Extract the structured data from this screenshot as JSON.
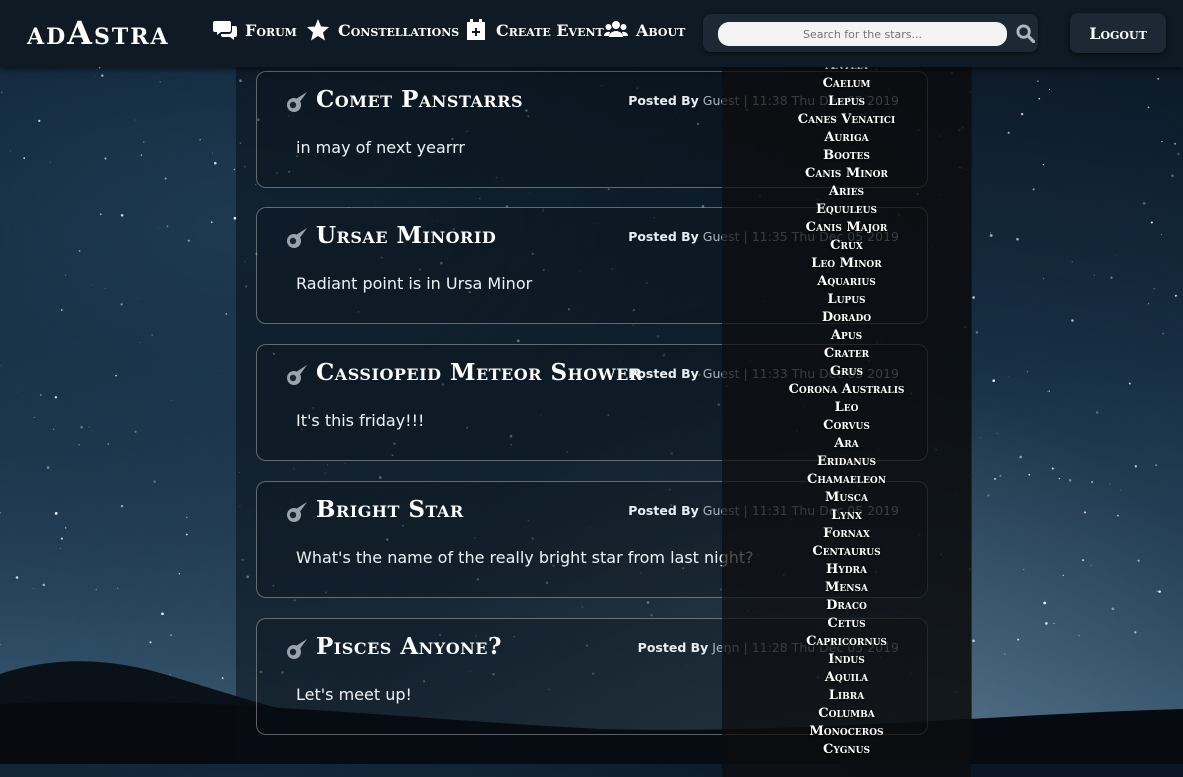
{
  "brand": "adAstra",
  "nav": {
    "forum": "Forum",
    "constellations": "Constellations",
    "create_event": "Create Event",
    "about": "About",
    "logout": "Logout"
  },
  "search": {
    "placeholder": "Search for the stars..."
  },
  "posts": [
    {
      "title": "Comet Panstarrs",
      "posted_by": "Posted By",
      "author": "Guest",
      "time": "11:38 Thu Dec 05 2019",
      "body": "in may of next yearrr"
    },
    {
      "title": "Ursae Minorid",
      "posted_by": "Posted By",
      "author": "Guest",
      "time": "11:35 Thu Dec 05 2019",
      "body": "Radiant point is in Ursa Minor"
    },
    {
      "title": "Cassiopeid Meteor Shower",
      "posted_by": "Posted By",
      "author": "Guest",
      "time": "11:33 Thu Dec 05 2019",
      "body": "It's this friday!!!"
    },
    {
      "title": "Bright Star",
      "posted_by": "Posted By",
      "author": "Guest",
      "time": "11:31 Thu Dec 05 2019",
      "body": "What's the name of the really bright star from last night?"
    },
    {
      "title": "Pisces Anyone?",
      "posted_by": "Posted By",
      "author": "Jenn",
      "time": "11:28 Thu Dec 05 2019",
      "body": "Let's meet up!"
    }
  ],
  "constellations": [
    "Antlia",
    "Caelum",
    "Lepus",
    "Canes Venatici",
    "Auriga",
    "Bootes",
    "Canis Minor",
    "Aries",
    "Equuleus",
    "Canis Major",
    "Crux",
    "Leo Minor",
    "Aquarius",
    "Lupus",
    "Dorado",
    "Apus",
    "Crater",
    "Grus",
    "Corona Australis",
    "Leo",
    "Corvus",
    "Ara",
    "Eridanus",
    "Chamaeleon",
    "Musca",
    "Lynx",
    "Fornax",
    "Centaurus",
    "Hydra",
    "Mensa",
    "Draco",
    "Cetus",
    "Capricornus",
    "Indus",
    "Aquila",
    "Libra",
    "Columba",
    "Monoceros",
    "Cygnus"
  ]
}
